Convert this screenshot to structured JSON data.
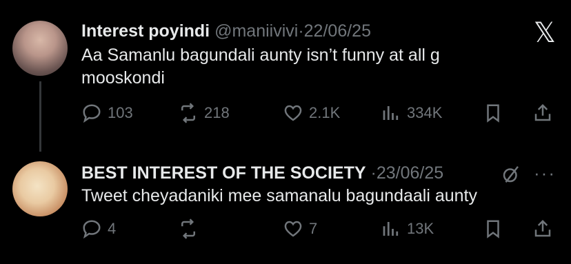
{
  "x_logo": "𝕏",
  "tweets": [
    {
      "name": "Interest poyindi",
      "handle": "@maniivivi",
      "separator": "·",
      "date": "22/06/25",
      "text": "Aa Samanlu bagundali aunty isn’t funny at all g mooskondi",
      "reply_count": "103",
      "retweet_count": "218",
      "like_count": "2.1K",
      "view_count": "334K"
    },
    {
      "name": "BEST INTEREST OF THE SOCIETY",
      "handle": "",
      "separator": "·",
      "date": "23/06/25",
      "text": "Tweet cheyadaniki mee samanalu bagundaali aunty",
      "reply_count": "4",
      "retweet_count": "",
      "like_count": "7",
      "view_count": "13K",
      "more": "···"
    }
  ],
  "colors": {
    "background": "#000000",
    "text": "#e7e9ea",
    "muted": "#71767b",
    "thread_line": "#333639"
  },
  "icons": [
    "reply-icon",
    "retweet-icon",
    "like-icon",
    "views-icon",
    "bookmark-icon",
    "share-icon",
    "x-logo-icon",
    "grok-icon",
    "more-icon"
  ]
}
